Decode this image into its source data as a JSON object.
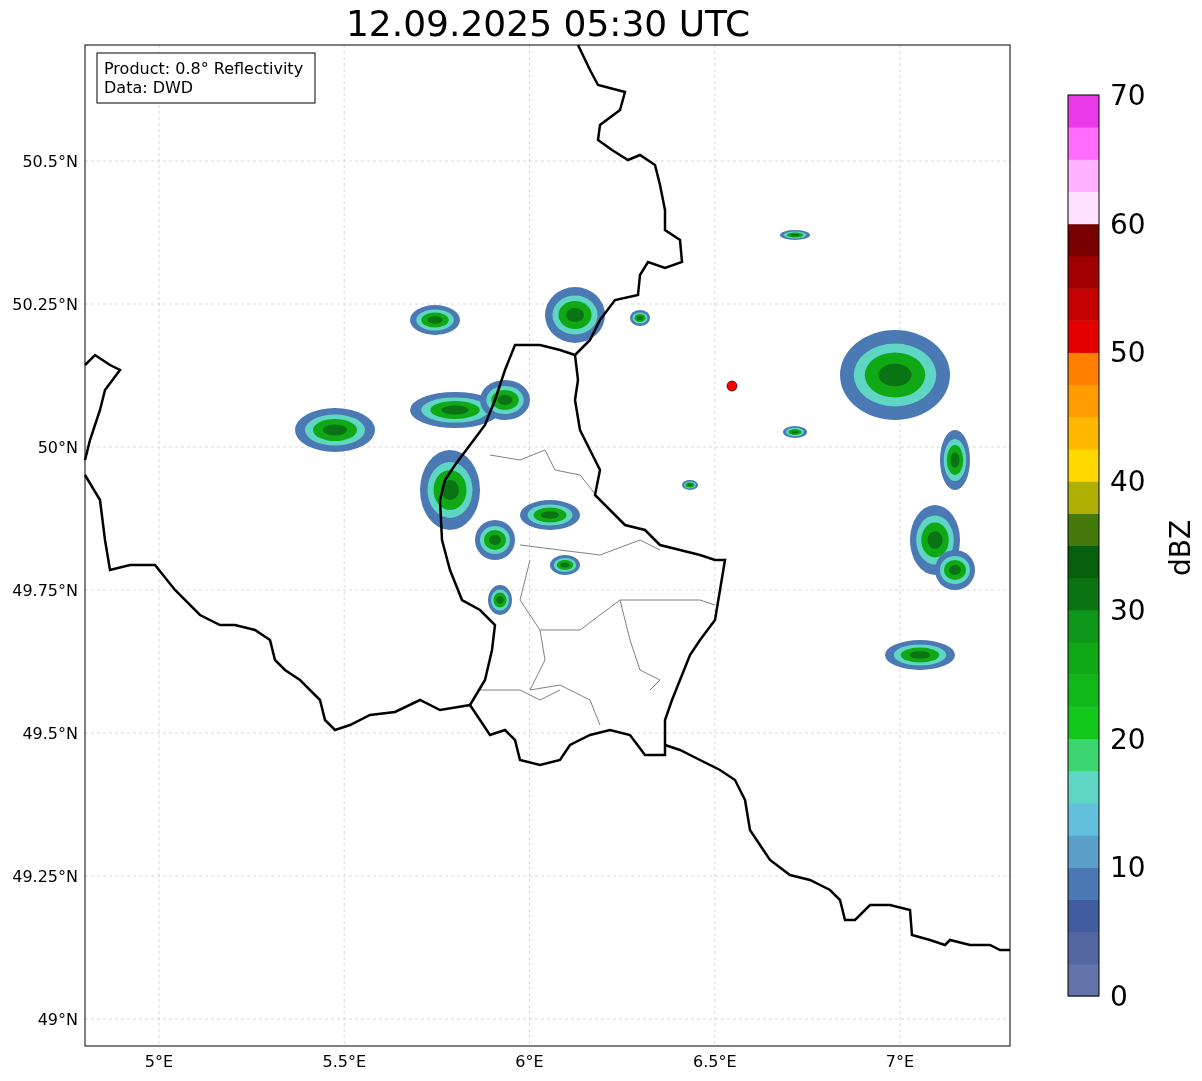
{
  "title": "12.09.2025 05:30 UTC",
  "info_box": {
    "lines": [
      "Product: 0.8° Reflectivity",
      "Data: DWD"
    ]
  },
  "map": {
    "x_ticks": [
      "5°E",
      "5.5°E",
      "6°E",
      "6.5°E",
      "7°E"
    ],
    "y_ticks": [
      "50.5°N",
      "50.25°N",
      "50°N",
      "49.75°N",
      "49.5°N",
      "49.25°N",
      "49°N"
    ],
    "marker": {
      "color": "#ff0000"
    }
  },
  "colorbar": {
    "label": "dBZ",
    "ticks": [
      "70",
      "60",
      "50",
      "40",
      "30",
      "20",
      "10",
      "0"
    ],
    "bands": [
      {
        "color": "#6474a8"
      },
      {
        "color": "#5466a0"
      },
      {
        "color": "#415da0"
      },
      {
        "color": "#4a79b4"
      },
      {
        "color": "#5b9fc8"
      },
      {
        "color": "#62c0dc"
      },
      {
        "color": "#5fd6c4"
      },
      {
        "color": "#3cd670"
      },
      {
        "color": "#12c81a"
      },
      {
        "color": "#10b81a"
      },
      {
        "color": "#10a814"
      },
      {
        "color": "#0e961a"
      },
      {
        "color": "#0a7414"
      },
      {
        "color": "#075e0c"
      },
      {
        "color": "#447a0c"
      },
      {
        "color": "#b0b004"
      },
      {
        "color": "#ffd800"
      },
      {
        "color": "#ffb800"
      },
      {
        "color": "#ff9c00"
      },
      {
        "color": "#ff8000"
      },
      {
        "color": "#e40000"
      },
      {
        "color": "#c40000"
      },
      {
        "color": "#a00000"
      },
      {
        "color": "#780000"
      },
      {
        "color": "#ffe0ff"
      },
      {
        "color": "#ffb2ff"
      },
      {
        "color": "#ff6cff"
      },
      {
        "color": "#e838e8"
      }
    ]
  }
}
